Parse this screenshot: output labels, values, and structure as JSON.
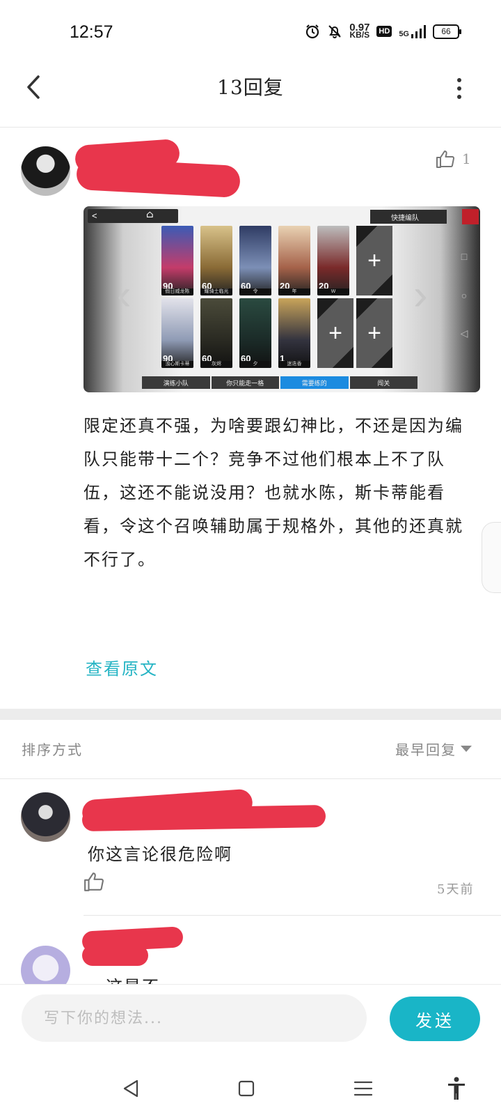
{
  "status_bar": {
    "time": "12:57",
    "net_speed_value": "0.97",
    "net_speed_unit": "KB/S",
    "hd_label": "HD",
    "network": "5G",
    "battery": "66"
  },
  "header": {
    "title": "13回复"
  },
  "post": {
    "like_count": "1",
    "body": "限定还真不强，为啥要跟幻神比，不还是因为编队只能带十二个？竞争不过他们根本上不了队伍，这还不能说没用？也就水陈，斯卡蒂能看看，令这个召唤辅助属于规格外，其他的还真就不行了。",
    "view_original": "查看原文",
    "image": {
      "quick_team_label": "快捷编队",
      "row1": [
        {
          "level": "90",
          "name": "假日威龙陈"
        },
        {
          "level": "60",
          "name": "耀骑士临光"
        },
        {
          "level": "60",
          "name": "令"
        },
        {
          "level": "20",
          "name": "年"
        },
        {
          "level": "20",
          "name": "W"
        }
      ],
      "row2": [
        {
          "level": "90",
          "name": "浊心斯卡蒂"
        },
        {
          "level": "60",
          "name": "灰烬"
        },
        {
          "level": "60",
          "name": "夕"
        },
        {
          "level": "1",
          "name": "迷迭香"
        }
      ],
      "tabs": [
        "演练小队",
        "你只能走一格",
        "需要练的",
        "闯关"
      ],
      "active_tab_index": 2
    }
  },
  "sort": {
    "label": "排序方式",
    "selected": "最早回复"
  },
  "replies": [
    {
      "text": "你这言论很危险啊",
      "time": "5天前"
    },
    {
      "text": "…这是不…"
    }
  ],
  "composer": {
    "placeholder": "写下你的想法...",
    "send_label": "发送"
  },
  "colors": {
    "accent": "#19b5c7",
    "redaction": "#e8364c"
  }
}
